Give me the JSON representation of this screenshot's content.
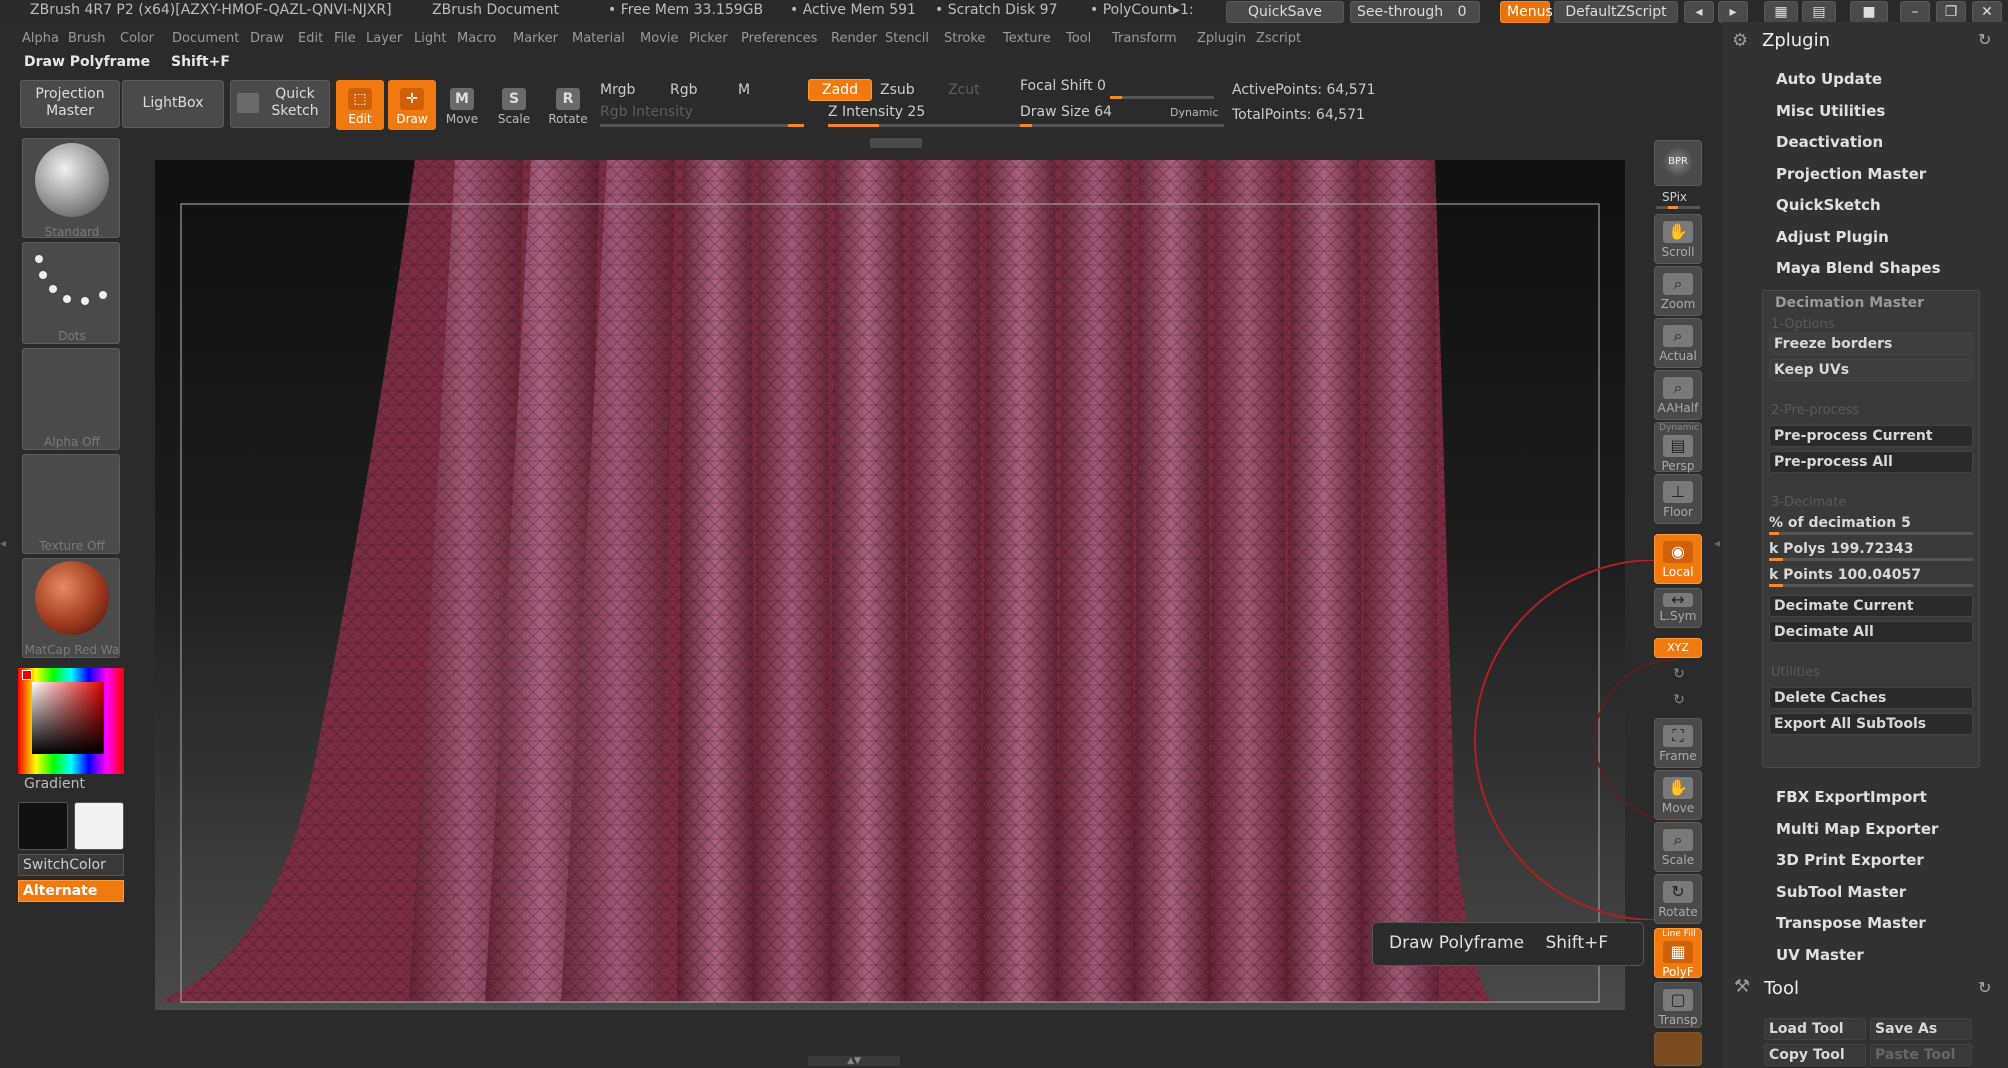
{
  "titlebar": {
    "app_title": "ZBrush 4R7 P2 (x64)[AZXY-HMOF-QAZL-QNVI-NJXR]",
    "document": "ZBrush Document",
    "free_mem": "• Free Mem 33.159GB",
    "active_mem": "• Active Mem 591",
    "scratch_disk": "• Scratch Disk 97",
    "polycount": "• PolyCount▸1:",
    "quicksave": "QuickSave",
    "see_through_label": "See-through",
    "see_through_value": "0",
    "menus": "Menus",
    "default_zscript": "DefaultZScript"
  },
  "menubar": [
    "Alpha",
    "Brush",
    "Color",
    "Document",
    "Draw",
    "Edit",
    "File",
    "Layer",
    "Light",
    "Macro",
    "Marker",
    "Material",
    "Movie",
    "Picker",
    "Preferences",
    "Render",
    "Stencil",
    "Stroke",
    "Texture",
    "Tool",
    "Transform",
    "Zplugin",
    "Zscript"
  ],
  "subtitle": {
    "label": "Draw Polyframe",
    "shortcut": "Shift+F"
  },
  "toolbar": {
    "projection_master": "Projection Master",
    "lightbox": "LightBox",
    "quick_sketch": "Quick Sketch",
    "edit": "Edit",
    "draw": "Draw",
    "move": "Move",
    "scale": "Scale",
    "rotate": "Rotate",
    "mrgb": "Mrgb",
    "rgb": "Rgb",
    "m": "M",
    "zadd": "Zadd",
    "zsub": "Zsub",
    "zcut": "Zcut",
    "rgb_intensity": "Rgb Intensity",
    "z_intensity": "Z Intensity 25",
    "z_intensity_fraction": 0.25,
    "focal_shift": "Focal Shift 0",
    "focal_shift_fraction": 0.0,
    "draw_size": "Draw Size 64",
    "draw_size_fraction": 0.06,
    "dynamic": "Dynamic",
    "active_points": "ActivePoints: 64,571",
    "total_points": "TotalPoints: 64,571"
  },
  "left_shelf": {
    "brush": "Standard",
    "stroke": "Dots",
    "alpha": "Alpha Off",
    "texture": "Texture Off",
    "material": "MatCap Red Wa",
    "gradient": "Gradient",
    "switch_color": "SwitchColor",
    "alternate": "Alternate"
  },
  "right_shelf": {
    "bpr": "BPR",
    "spix": "SPix",
    "scroll": "Scroll",
    "zoom": "Zoom",
    "actual": "Actual",
    "aahalf": "AAHalf",
    "dynamic": "Dynamic",
    "persp": "Persp",
    "floor": "Floor",
    "local": "Local",
    "lsym": "L.Sym",
    "xyz": "XYZ",
    "frame": "Frame",
    "move": "Move",
    "scale": "Scale",
    "rotate": "Rotate",
    "polyf": "PolyF",
    "linefill": "Line Fill",
    "transp": "Transp"
  },
  "tooltip": {
    "label": "Draw Polyframe",
    "shortcut": "Shift+F"
  },
  "zplugin": {
    "title": "Zplugin",
    "items": [
      "Auto Update",
      "Misc Utilities",
      "Deactivation",
      "Projection Master",
      "QuickSketch",
      "Adjust Plugin",
      "Maya Blend Shapes"
    ],
    "decimation": {
      "title": "Decimation Master",
      "options_header": "1-Options",
      "freeze_borders": "Freeze borders",
      "keep_uvs": "Keep UVs",
      "preprocess_header": "2-Pre-process",
      "preprocess_current": "Pre-process Current",
      "preprocess_all": "Pre-process All",
      "decimate_header": "3-Decimate",
      "pct_decimation": "% of decimation 5",
      "pct_decimation_fraction": 0.05,
      "k_polys": "k Polys 199.72343",
      "k_polys_fraction": 0.07,
      "k_points": "k Points 100.04057",
      "k_points_fraction": 0.07,
      "decimate_current": "Decimate Current",
      "decimate_all": "Decimate All",
      "utilities_header": "Utilities",
      "delete_caches": "Delete Caches",
      "export_all": "Export All SubTools"
    },
    "more_items": [
      "FBX ExportImport",
      "Multi Map Exporter",
      "3D Print Exporter",
      "SubTool Master",
      "Transpose Master",
      "UV Master"
    ],
    "tool_title": "Tool",
    "load_tool": "Load Tool",
    "save_as": "Save As",
    "copy_tool": "Copy Tool",
    "paste_tool": "Paste Tool"
  },
  "colors": {
    "accent": "#f07a10",
    "panel": "#323232",
    "bg": "#2b2b2b",
    "cloth": "#8a3a55"
  }
}
